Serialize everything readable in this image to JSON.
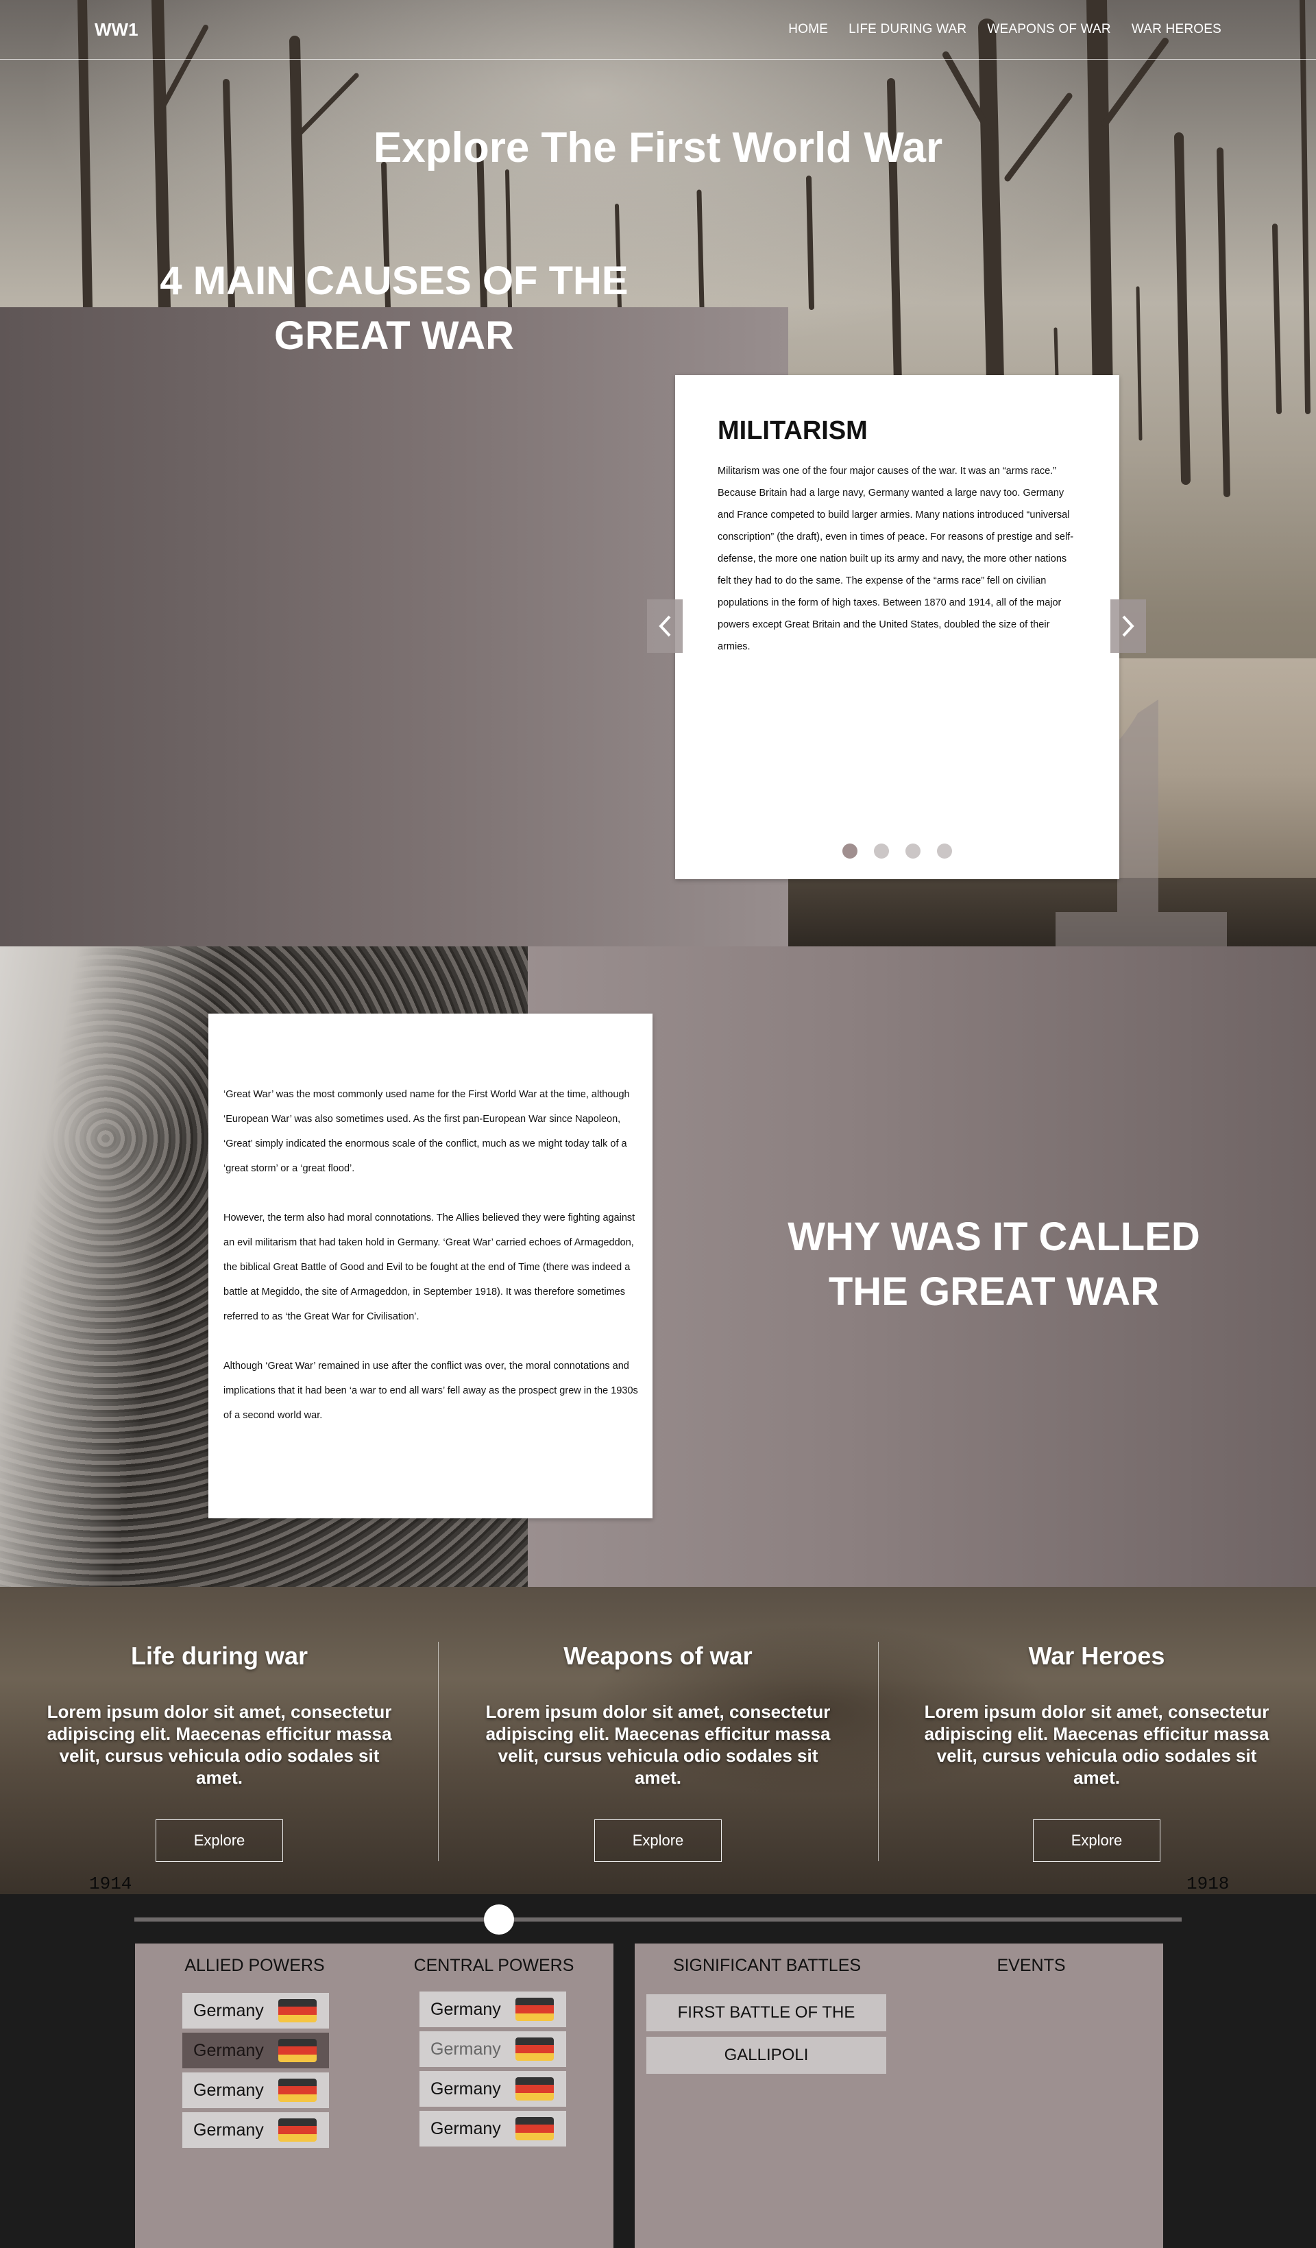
{
  "nav": {
    "logo": "WW1",
    "items": [
      "HOME",
      "LIFE DURING WAR",
      "WEAPONS OF WAR",
      "WAR HEROES"
    ]
  },
  "hero": {
    "title": "Explore The First World War"
  },
  "causes": {
    "heading": "4 MAIN CAUSES OF THE GREAT WAR",
    "card_title": "MILITARISM",
    "card_text": "Militarism was one of the four major causes of the war. It was an “arms race.” Because Britain had a large navy, Germany wanted a large navy too. Germany and France competed to build larger armies. Many nations introduced “universal conscription” (the draft), even in times of peace. For reasons of prestige and self-defense, the more one nation built up its army and navy, the more other nations felt they had to do the same. The expense of the “arms race” fell on civilian populations in the form of high taxes. Between 1870 and 1914, all of the major powers except Great Britain and the United States, doubled the size of their armies.",
    "slides": 4,
    "active_slide": 1
  },
  "great_war": {
    "heading": "WHY WAS IT CALLED THE GREAT WAR",
    "paragraphs": [
      "‘Great War’ was the most commonly used name for the First World War at the time, although ‘European War’ was also sometimes used. As the first pan-European War since Napoleon, ‘Great’ simply indicated the enormous scale of the conflict, much as we might today talk of a ‘great storm’ or a ‘great flood’.",
      "However, the term also had moral connotations. The Allies believed they were fighting against an evil militarism that had taken hold in Germany. ‘Great War’ carried echoes of Armageddon, the biblical Great Battle of Good and Evil to be fought at the end of Time (there was indeed a battle at Megiddo, the site of Armageddon, in September 1918). It was therefore sometimes referred to as ‘the Great War for Civilisation’.",
      "Although ‘Great War’ remained in use after the conflict was over, the moral connotations and implications that it had been ‘a war to end all wars’ fell away as the prospect grew in the 1930s of a second world war."
    ]
  },
  "topics": [
    {
      "title": "Life during war",
      "text": "Lorem ipsum dolor sit amet, consectetur adipiscing elit. Maecenas efficitur massa velit, cursus vehicula odio sodales sit amet.",
      "button": "Explore"
    },
    {
      "title": "Weapons of war",
      "text": "Lorem ipsum dolor sit amet, consectetur adipiscing elit. Maecenas efficitur massa velit, cursus vehicula odio sodales sit amet.",
      "button": "Explore"
    },
    {
      "title": "War Heroes",
      "text": "Lorem ipsum dolor sit amet, consectetur adipiscing elit. Maecenas efficitur massa velit, cursus vehicula odio sodales sit amet.",
      "button": "Explore"
    }
  ],
  "timeline": {
    "start_year": "1914",
    "end_year": "1918",
    "allied": {
      "title": "ALLIED POWERS",
      "countries": [
        "Germany",
        "Germany",
        "Germany",
        "Germany"
      ]
    },
    "central": {
      "title": "CENTRAL POWERS",
      "countries": [
        "Germany",
        "Germany",
        "Germany",
        "Germany"
      ]
    },
    "battles": {
      "title": "SIGNIFICANT BATTLES",
      "items": [
        "FIRST BATTLE OF THE MARNE",
        "GALLIPOLI"
      ]
    },
    "events": {
      "title": "EVENTS"
    }
  },
  "colors": {
    "panel": "#9d9090",
    "flag_top": "#333333",
    "flag_mid": "#dd3c2c",
    "flag_bottom": "#f5c542"
  }
}
